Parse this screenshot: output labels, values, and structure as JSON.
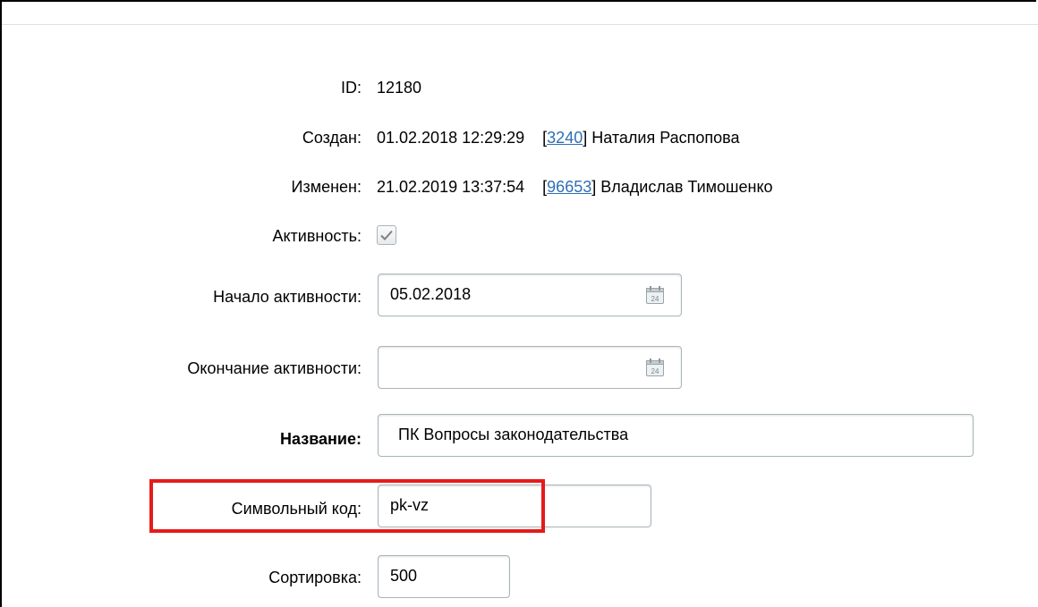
{
  "form": {
    "id": {
      "label": "ID:",
      "value": "12180"
    },
    "created": {
      "label": "Создан:",
      "datetime": "01.02.2018 12:29:29",
      "user_id": "3240",
      "user_name": "Наталия Распопова"
    },
    "modified": {
      "label": "Изменен:",
      "datetime": "21.02.2019 13:37:54",
      "user_id": "96653",
      "user_name": "Владислав Тимошенко"
    },
    "active": {
      "label": "Активность:",
      "checked": true
    },
    "active_from": {
      "label": "Начало активности:",
      "value": "05.02.2018"
    },
    "active_to": {
      "label": "Окончание активности:",
      "value": ""
    },
    "name": {
      "label": "Название:",
      "value": "ПК Вопросы законодательства"
    },
    "code": {
      "label": "Символьный код:",
      "value": "pk-vz"
    },
    "sort": {
      "label": "Сортировка:",
      "value": "500"
    }
  },
  "icons": {
    "calendar": "calendar-icon",
    "check": "checkmark-icon"
  },
  "colors": {
    "highlight": "#e51b1b",
    "link": "#2f6fb5"
  }
}
